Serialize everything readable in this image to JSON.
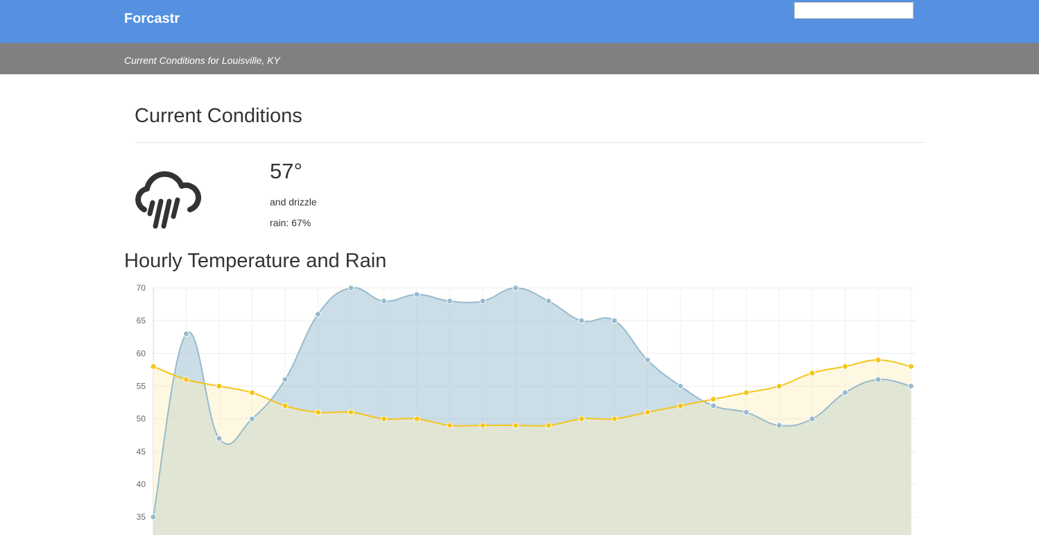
{
  "header": {
    "brand": "Forcastr",
    "search": {
      "value": "",
      "placeholder": ""
    }
  },
  "subheader": {
    "text": "Current Conditions for Louisville, KY"
  },
  "current": {
    "title": "Current Conditions",
    "icon": "rain-cloud-icon",
    "temperature": "57°",
    "summary": "and drizzle",
    "rain_label": "rain:",
    "rain_value": "67%"
  },
  "hourly": {
    "title": "Hourly Temperature and Rain"
  },
  "colors": {
    "header_bg": "#5591e0",
    "subheader_bg": "#808080",
    "series_blue_line": "#97bbcd",
    "series_blue_fill": "rgba(151,187,205,0.5)",
    "series_yellow_line": "#f5c518",
    "series_yellow_fill": "rgba(253,240,190,0.45)"
  },
  "chart_data": {
    "type": "line",
    "title": "",
    "xlabel": "",
    "ylabel": "",
    "ylim": [
      35,
      70
    ],
    "ticks": [
      35,
      40,
      45,
      50,
      55,
      60,
      65,
      70
    ],
    "grid": true,
    "x": [
      0,
      1,
      2,
      3,
      4,
      5,
      6,
      7,
      8,
      9,
      10,
      11,
      12,
      13,
      14,
      15,
      16,
      17,
      18,
      19,
      20,
      21,
      22,
      23
    ],
    "series": [
      {
        "color": "#97bbcd",
        "values": [
          35,
          63,
          47,
          50,
          56,
          66,
          70,
          68,
          69,
          68,
          68,
          70,
          68,
          65,
          65,
          59,
          55,
          52,
          51,
          49,
          50,
          54,
          56,
          55
        ]
      },
      {
        "color": "#f5c518",
        "values": [
          58,
          56,
          55,
          54,
          52,
          51,
          51,
          50,
          50,
          49,
          49,
          49,
          49,
          50,
          50,
          51,
          52,
          53,
          54,
          55,
          57,
          58,
          59,
          58
        ]
      }
    ]
  }
}
